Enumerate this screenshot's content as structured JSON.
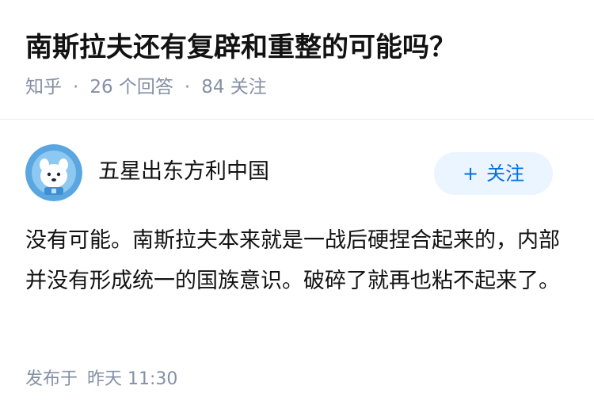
{
  "question": {
    "title": "南斯拉夫还有复辟和重整的可能吗？",
    "source": "知乎",
    "answer_count": "26 个回答",
    "follow_count": "84 关注",
    "separator": "·"
  },
  "answer": {
    "author_name": "五星出东方利中国",
    "follow_button_label": "关注",
    "follow_icon": "plus-icon",
    "content": "没有可能。南斯拉夫本来就是一战后硬捏合起来的，内部并没有形成统一的国族意识。破碎了就再也粘不起来了。",
    "publish_label": "发布于",
    "publish_time": "昨天 11:30"
  },
  "colors": {
    "title": "#121212",
    "meta": "#8590a6",
    "accent": "#056de8",
    "follow_bg": "#ebf5ff",
    "avatar_bg": "#5aa6e0"
  }
}
